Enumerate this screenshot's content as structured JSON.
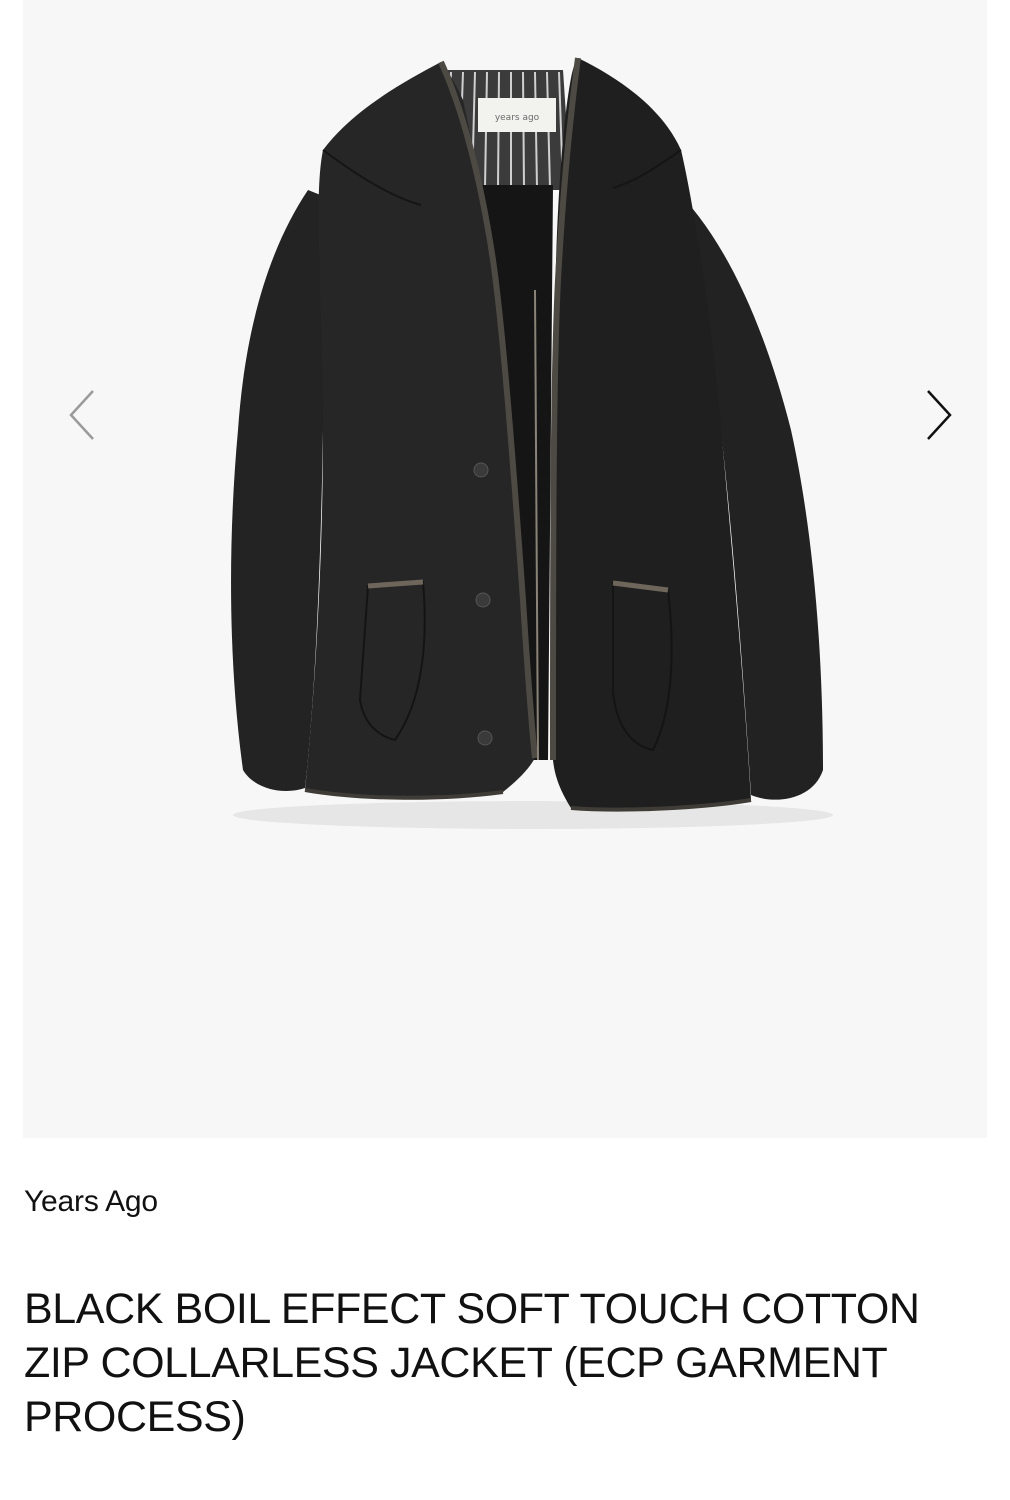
{
  "gallery": {
    "image_subject": "black collarless zip jacket",
    "label_text": "years ago",
    "prev_icon": "chevron-left-icon",
    "next_icon": "chevron-right-icon",
    "prev_arrow_color": "#9a9a9a",
    "next_arrow_color": "#111111"
  },
  "product": {
    "brand": "Years Ago",
    "title": "BLACK BOIL EFFECT SOFT TOUCH COTTON ZIP COLLARLESS JACKET (ECP GARMENT PROCESS)"
  }
}
